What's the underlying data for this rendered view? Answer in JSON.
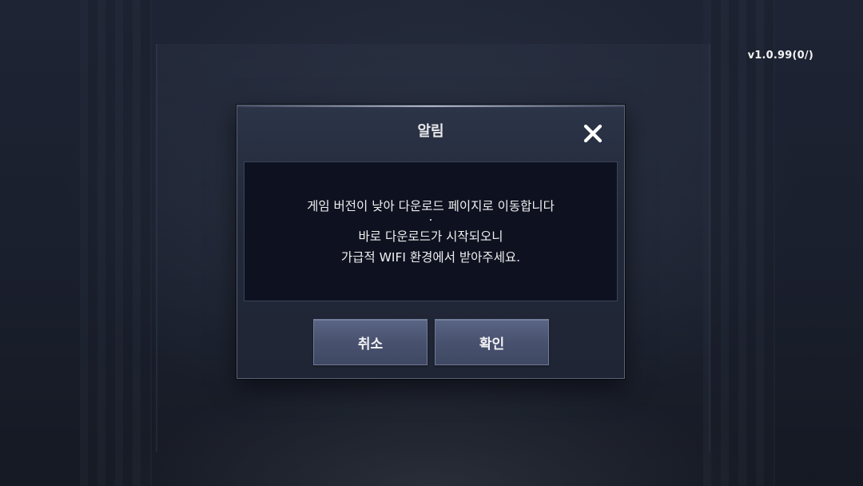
{
  "version_label": "v1.0.99(0/)",
  "dialog": {
    "title": "알림",
    "close_icon": "close-icon",
    "message_lines": [
      "게임 버전이 낮아 다운로드 페이지로 이동합니다",
      ".",
      "바로 다운로드가 시작되오니",
      "가급적 WIFI 환경에서 받아주세요."
    ],
    "buttons": {
      "cancel_label": "취소",
      "confirm_label": "확인"
    }
  },
  "colors": {
    "dialog_background": "#222939",
    "message_background": "#0e1220",
    "button_background": "#4a5471",
    "text": "#f0f0f0"
  }
}
